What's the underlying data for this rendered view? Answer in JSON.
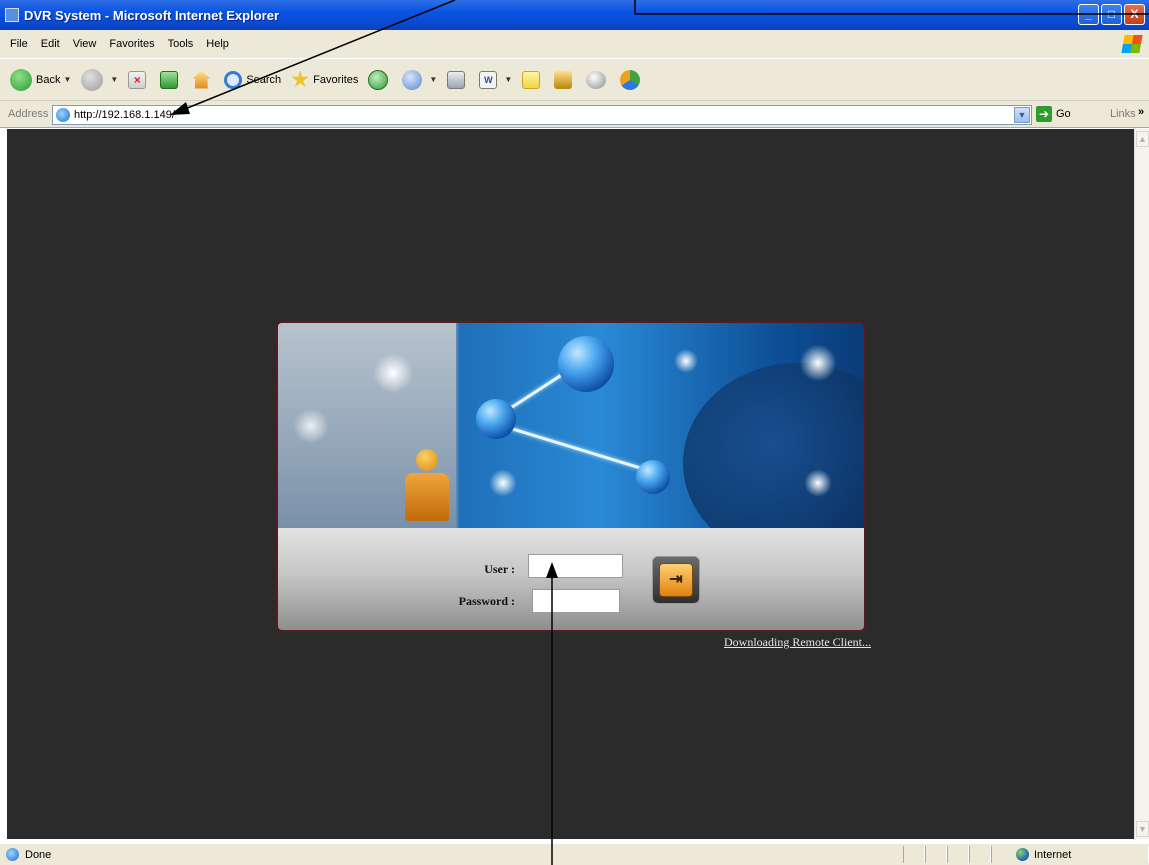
{
  "window": {
    "title": "DVR System - Microsoft Internet Explorer",
    "controls": {
      "minimize": "_",
      "maximize": "□",
      "close": "X"
    }
  },
  "menubar": [
    "File",
    "Edit",
    "View",
    "Favorites",
    "Tools",
    "Help"
  ],
  "toolbar": {
    "back_label": "Back",
    "search_label": "Search",
    "favorites_label": "Favorites"
  },
  "address": {
    "label": "Address",
    "url": "http://192.168.1.149/",
    "go_label": "Go",
    "links_label": "Links",
    "links_chevron": "»"
  },
  "login": {
    "user_label": "User :",
    "password_label": "Password :",
    "user_value": "",
    "password_value": "",
    "login_button_glyph": "⇥",
    "download_link": "Downloading Remote Client..."
  },
  "status": {
    "text": "Done",
    "zone": "Internet"
  },
  "colors": {
    "title_bar": "#0a54e3",
    "chrome": "#ece9d8",
    "content_bg": "#2b2b2b",
    "login_button": "#e0820f"
  }
}
